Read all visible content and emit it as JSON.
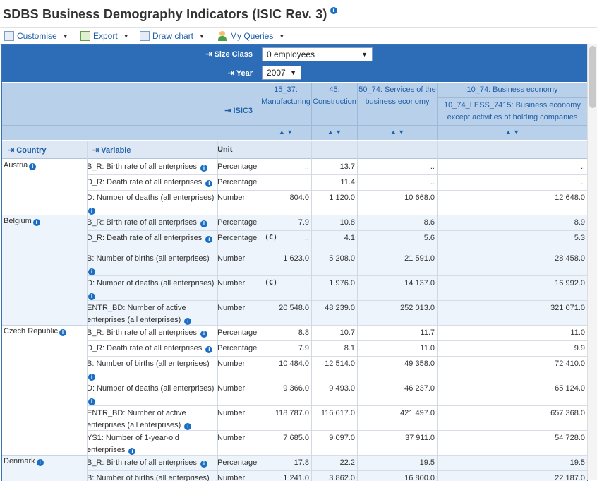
{
  "title": "SDBS Business Demography Indicators (ISIC Rev. 3)",
  "toolbar": {
    "customise": "Customise",
    "export": "Export",
    "draw_chart": "Draw chart",
    "my_queries": "My Queries"
  },
  "filters": {
    "size_class_label": "Size Class",
    "size_class_value": "0 employees",
    "year_label": "Year",
    "year_value": "2007",
    "isic3_label": "ISIC3"
  },
  "columns": {
    "c1": "15_37: Manufacturing",
    "c2": "45: Construction",
    "c3": "50_74: Services of the business economy",
    "c4_top": "10_74: Business economy",
    "c4": "10_74_LESS_7415: Business economy except activities of holding companies"
  },
  "dim_headers": {
    "country": "Country",
    "variable": "Variable",
    "unit": "Unit"
  },
  "colors": {
    "header_blue": "#2d6db7",
    "header_light": "#b9d0ea",
    "link": "#1f5fa8",
    "alt_row": "#eef4fb"
  },
  "rows": [
    {
      "country": "Austria",
      "variable": "B_R: Birth rate of all enterprises",
      "unit": "Percentage",
      "v": [
        "..",
        "13.7",
        "..",
        ".."
      ]
    },
    {
      "variable": "D_R: Death rate of all enterprises",
      "unit": "Percentage",
      "v": [
        "..",
        "11.4",
        "..",
        ".."
      ]
    },
    {
      "variable": "D: Number of deaths (all enterprises)",
      "unit": "Number",
      "v": [
        "804.0",
        "1 120.0",
        "10 668.0",
        "12 648.0"
      ]
    },
    {
      "country": "Belgium",
      "variable": "B_R: Birth rate of all enterprises",
      "unit": "Percentage",
      "v": [
        "7.9",
        "10.8",
        "8.6",
        "8.9"
      ]
    },
    {
      "variable": "D_R: Death rate of all enterprises",
      "unit": "Percentage",
      "flag": "(C)",
      "v": [
        "..",
        "4.1",
        "5.6",
        "5.3"
      ]
    },
    {
      "variable": "B: Number of births (all enterprises)",
      "unit": "Number",
      "v": [
        "1 623.0",
        "5 208.0",
        "21 591.0",
        "28 458.0"
      ]
    },
    {
      "variable": "D: Number of deaths (all enterprises)",
      "unit": "Number",
      "flag": "(C)",
      "v": [
        "..",
        "1 976.0",
        "14 137.0",
        "16 992.0"
      ]
    },
    {
      "variable": "ENTR_BD: Number of active enterprises (all enterprises)",
      "unit": "Number",
      "v": [
        "20 548.0",
        "48 239.0",
        "252 013.0",
        "321 071.0"
      ]
    },
    {
      "country": "Czech Republic",
      "variable": "B_R: Birth rate of all enterprises",
      "unit": "Percentage",
      "v": [
        "8.8",
        "10.7",
        "11.7",
        "11.0"
      ]
    },
    {
      "variable": "D_R: Death rate of all enterprises",
      "unit": "Percentage",
      "v": [
        "7.9",
        "8.1",
        "11.0",
        "9.9"
      ]
    },
    {
      "variable": "B: Number of births (all enterprises)",
      "unit": "Number",
      "v": [
        "10 484.0",
        "12 514.0",
        "49 358.0",
        "72 410.0"
      ]
    },
    {
      "variable": "D: Number of deaths (all enterprises)",
      "unit": "Number",
      "v": [
        "9 366.0",
        "9 493.0",
        "46 237.0",
        "65 124.0"
      ]
    },
    {
      "variable": "ENTR_BD: Number of active enterprises (all enterprises)",
      "unit": "Number",
      "v": [
        "118 787.0",
        "116 617.0",
        "421 497.0",
        "657 368.0"
      ]
    },
    {
      "variable": "YS1: Number of 1-year-old enterprises",
      "unit": "Number",
      "v": [
        "7 685.0",
        "9 097.0",
        "37 911.0",
        "54 728.0"
      ]
    },
    {
      "country": "Denmark",
      "variable": "B_R: Birth rate of all enterprises",
      "unit": "Percentage",
      "v": [
        "17.8",
        "22.2",
        "19.5",
        "19.5"
      ]
    },
    {
      "variable": "B: Number of births (all enterprises)",
      "unit": "Number",
      "v": [
        "1 241.0",
        "3 862.0",
        "16 800.0",
        "22 187.0"
      ]
    }
  ]
}
